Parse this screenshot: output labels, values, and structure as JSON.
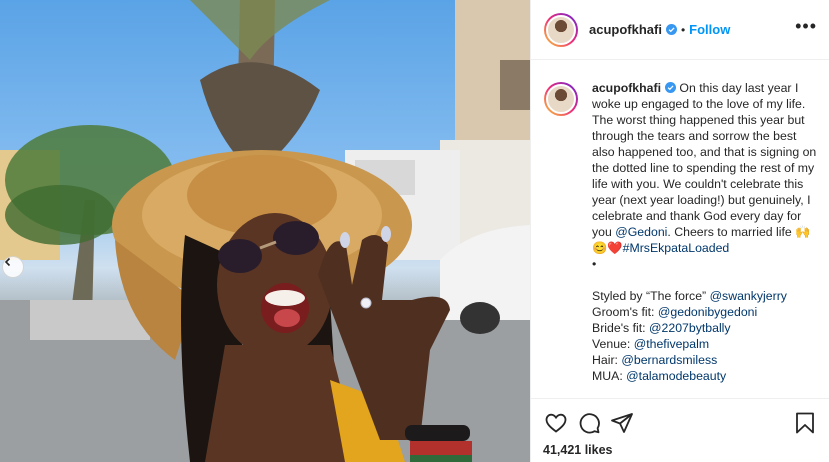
{
  "post": {
    "username": "acupofkhafi",
    "follow_label": "Follow",
    "separator": "•",
    "more_label": "•••"
  },
  "caption": {
    "username": "acupofkhafi",
    "text_1": " On this day last year I woke up engaged to the love of my life. The worst thing happened this year but through the tears and sorrow the best also happened too, and that is signing on the dotted line to spending the rest of my life with you. We couldn't celebrate this year (next year loading!) but genuinely, I celebrate and thank God every day for you ",
    "mention_1": "@Gedoni",
    "text_2": ". Cheers to married life ",
    "emojis": "🙌😊❤️",
    "hashtag": "#MrsEkpataLoaded",
    "bullet": "•",
    "credits": [
      {
        "label": "Styled by “The force” ",
        "mention": "@swankyjerry"
      },
      {
        "label": "Groom's fit: ",
        "mention": "@gedonibygedoni"
      },
      {
        "label": "Bride's fit: ",
        "mention": "@2207bytbally"
      },
      {
        "label": "Venue: ",
        "mention": "@thefivepalm"
      },
      {
        "label": "Hair: ",
        "mention": "@bernardsmiless"
      },
      {
        "label": "MUA: ",
        "mention": "@talamodebeauty"
      }
    ]
  },
  "likes": {
    "count_text": "41,421 likes"
  },
  "colors": {
    "link": "#0095f6",
    "mention": "#00376b",
    "text": "#262626",
    "border": "#efefef"
  },
  "icons": [
    "verified-badge-icon",
    "more-options-icon",
    "heart-icon",
    "comment-icon",
    "share-icon",
    "bookmark-icon",
    "chevron-left-icon"
  ]
}
